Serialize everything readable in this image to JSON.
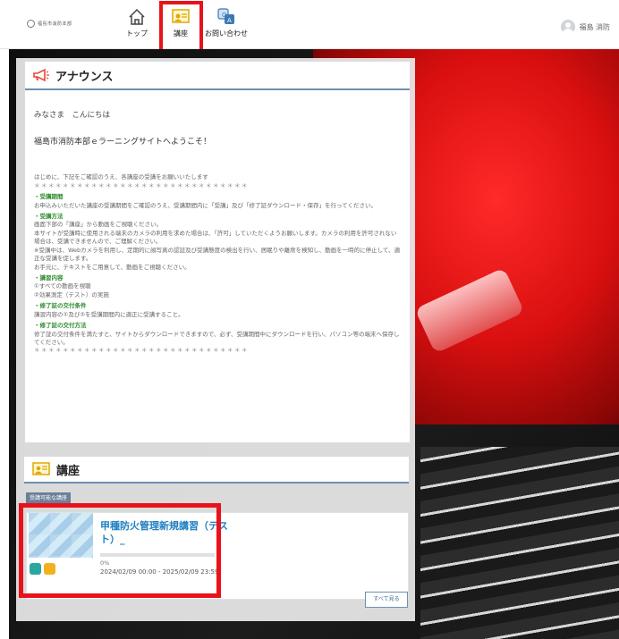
{
  "header": {
    "logo_text": "福島市消防本部",
    "nav": [
      {
        "label": "トップ",
        "icon": "home-icon"
      },
      {
        "label": "講座",
        "icon": "course-icon"
      },
      {
        "label": "お問い合わせ",
        "icon": "contact-icon"
      }
    ],
    "user_name": "福島 消防"
  },
  "announcement": {
    "title": "アナウンス",
    "greeting": "みなさま　こんにちは",
    "welcome": "福島市消防本部ｅラーニングサイトへようこそ！",
    "intro": "はじめに、下記をご確認のうえ、各講座の受講をお願いいたします",
    "stars": "＊＊＊＊＊＊＊＊＊＊＊＊＊＊＊＊＊＊＊＊＊＊＊＊＊＊＊＊＊＊",
    "sec1_title": "・受講期間",
    "sec1_text": "お申込みいただいた講座の受講期間をご確認のうえ、受講期間内に「受講」及び「修了証ダウンロード・保存」を行ってください。",
    "sec2_title": "・受講方法",
    "sec2_text1": "画面下部の「講座」から動画をご視聴ください。",
    "sec2_text2": "本サイトが受講時に使用される端末のカメラの利用を求めた場合は、「許可」していただくようお願いします。カメラの利用を許可されない場合は、受講できませんので、ご理解ください。",
    "sec2_text3": "※受講中は、Webカメラを利用し、定期的に顔写真の認証及び受講態度の検出を行い、居眠りや離席を検知し、動画を一時的に停止して、適正な受講を促します。",
    "sec2_text4": "お手元に、テキストをご用意して、動画をご視聴ください。",
    "sec3_title": "・講習内容",
    "sec3_item1": "①すべての動画を視聴",
    "sec3_item2": "②効果測定（テスト）の実施",
    "sec4_title": "・修了証の交付条件",
    "sec4_text": "講習内容の①及び②を受講期間内に適正に受講すること。",
    "sec5_title": "・修了証の交付方法",
    "sec5_text": "修了証の交付条件を満たすと、サイトからダウンロードできますので、必ず、受講期間中にダウンロードを行い、パソコン等の端末へ保存してください。",
    "stars_end": "＊＊＊＊＊＊＊＊＊＊＊＊＊＊＊＊＊＊＊＊＊＊＊＊＊＊＊＊＊＊"
  },
  "courses": {
    "title": "講座",
    "filter_label": "受講可能な講座",
    "items": [
      {
        "name": "甲種防火管理新規講習（テスト）_",
        "progress": 0,
        "progress_text": "0%",
        "period": "2024/02/09 00:00 - 2025/02/09 23:59"
      }
    ],
    "see_all": "すべて見る"
  },
  "colors": {
    "accent": "#1e7fc1",
    "highlight": "#e8131a",
    "section_green": "#2e8b2e"
  }
}
